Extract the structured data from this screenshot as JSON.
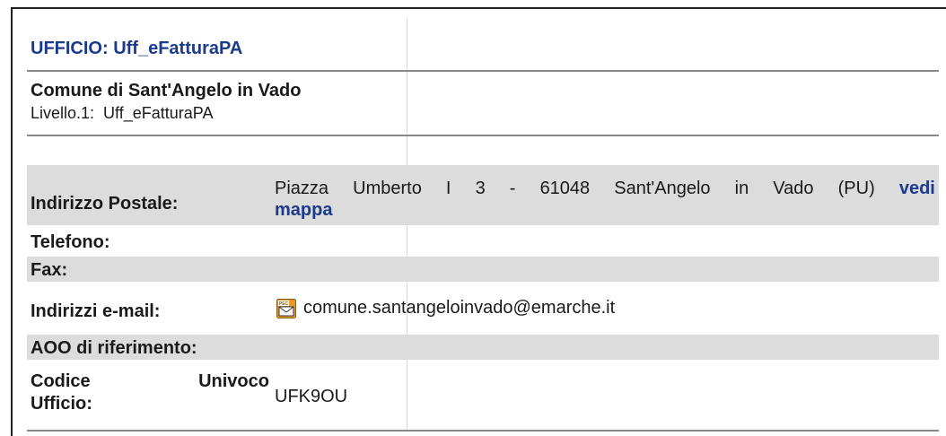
{
  "office": {
    "title": "UFFICIO: Uff_eFatturaPA"
  },
  "ente": {
    "name": "Comune di Sant'Angelo in Vado",
    "level_label": "Livello.1:",
    "level_value": "Uff_eFatturaPA"
  },
  "details": {
    "address": {
      "label": "Indirizzo Postale:",
      "words": [
        "Piazza",
        "Umberto",
        "I",
        "3",
        "-",
        "61048",
        "Sant'Angelo",
        "in",
        "Vado",
        "(PU)"
      ],
      "map_link_1": "vedi",
      "map_link_2": "mappa"
    },
    "phone": {
      "label": "Telefono:",
      "value": ""
    },
    "fax": {
      "label": "Fax:",
      "value": ""
    },
    "email": {
      "label": "Indirizzi e-mail:",
      "icon": "pec-mail-icon",
      "value": "comune.santangeloinvado@emarche.it"
    },
    "aoo": {
      "label": "AOO di riferimento:",
      "value": ""
    },
    "code": {
      "label_parts": [
        "Codice",
        "Univoco",
        "Ufficio:"
      ],
      "value": "UFK9OU"
    }
  },
  "colors": {
    "heading": "#1b3a8c",
    "row_shade": "#dcdcdc",
    "pec_icon": "#e39b2f"
  }
}
